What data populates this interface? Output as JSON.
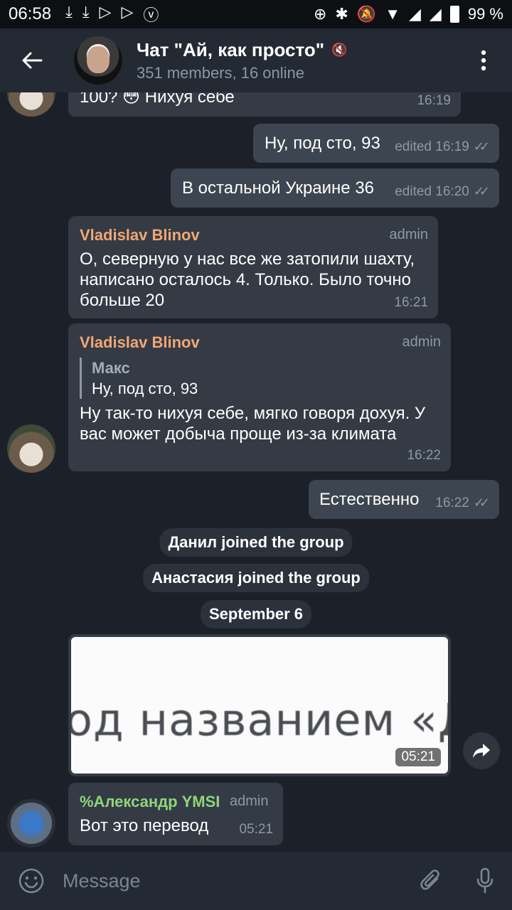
{
  "status": {
    "time": "06:58",
    "battery": "99 %"
  },
  "header": {
    "title": "Чат \"Ай, как просто\"",
    "subtitle": "351 members, 16 online"
  },
  "messages": [
    {
      "text": "100? 😳 Нихуя себе",
      "time": "16:19"
    },
    {
      "text": "Ну, под сто, 93",
      "time": "edited 16:19"
    },
    {
      "text": "В остальной Украине 36",
      "time": "edited 16:20"
    },
    {
      "sender": "Vladislav Blinov",
      "badge": "admin",
      "text": "О, северную у нас все же затопили шахту, написано осталось 4. Только. Было точно больше 20",
      "time": "16:21"
    },
    {
      "sender": "Vladislav Blinov",
      "badge": "admin",
      "quote_name": "Макс",
      "quote_text": "Ну, под сто, 93",
      "text": "Ну так-то нихуя себе, мягко говоря дохуя. У вас может добыча проще из-за климата",
      "time": "16:22"
    },
    {
      "text": "Естественно",
      "time": "16:22"
    },
    {
      "sender": "%Александр YMSI",
      "badge": "admin",
      "text": "Вот это перевод",
      "time": "05:21"
    }
  ],
  "service": {
    "joined1": "Данил joined the group",
    "joined2": "Анастасия joined the group",
    "date": "September 6"
  },
  "photo": {
    "text": "од названием «Д",
    "time": "05:21"
  },
  "input": {
    "placeholder": "Message"
  },
  "colors": {
    "sender_orange": "#f3a673",
    "sender_green": "#8fd57a",
    "bubble_in": "#343b45",
    "bubble_out": "#3d4550",
    "background": "#1c2129"
  }
}
